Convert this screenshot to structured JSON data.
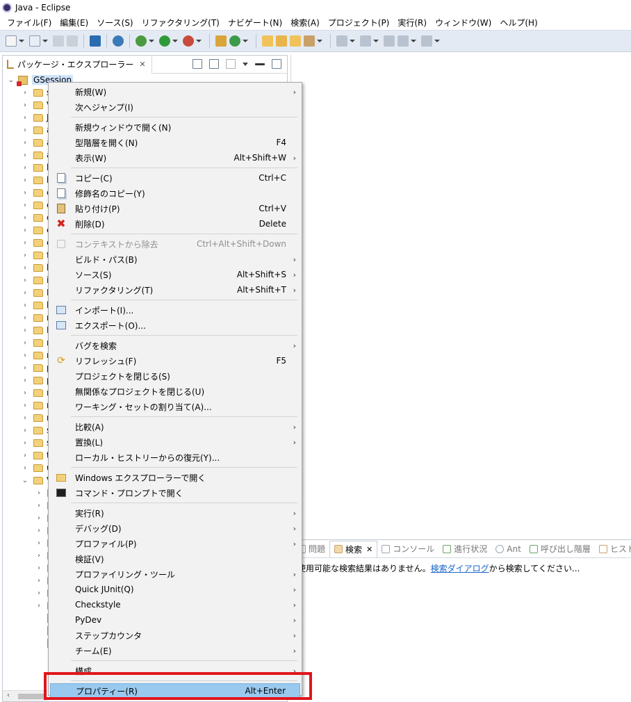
{
  "window": {
    "title": "Java - Eclipse"
  },
  "menubar": {
    "items": [
      "ファイル(F)",
      "編集(E)",
      "ソース(S)",
      "リファクタリング(T)",
      "ナビゲート(N)",
      "検索(A)",
      "プロジェクト(P)",
      "実行(R)",
      "ウィンドウ(W)",
      "ヘルプ(H)"
    ]
  },
  "package_explorer": {
    "tab_label": "パッケージ・エクスプローラー",
    "close_glyph": "✕",
    "project": "GSession",
    "tree_letters": [
      "s",
      "V",
      "J",
      "a",
      "a",
      "a",
      "b",
      "b",
      "c",
      "c",
      "c",
      "e",
      "e",
      "f",
      "h",
      "i",
      "L",
      "l",
      "n",
      "N",
      "n",
      "n",
      "p",
      "p",
      "r",
      "r",
      "r",
      "s",
      "s",
      "t",
      "u",
      "V"
    ]
  },
  "bottom_panel": {
    "tabs": [
      {
        "label": "問題",
        "active": false
      },
      {
        "label": "検索",
        "active": true
      },
      {
        "label": "コンソール",
        "active": false
      },
      {
        "label": "進行状況",
        "active": false
      },
      {
        "label": "Ant",
        "active": false
      },
      {
        "label": "呼び出し階層",
        "active": false
      },
      {
        "label": "ヒストリー",
        "active": false
      }
    ],
    "message_prefix": "使用可能な検索結果はありません。",
    "message_link": "検索ダイアログ",
    "message_suffix": "から検索してください..."
  },
  "context_menu": {
    "items": [
      {
        "label": "新規(W)",
        "shortcut": "",
        "submenu": true,
        "icon": ""
      },
      {
        "label": "次へジャンプ(I)",
        "shortcut": "",
        "submenu": false,
        "icon": ""
      },
      {
        "label": "新規ウィンドウで開く(N)",
        "shortcut": "",
        "submenu": false,
        "icon": ""
      },
      {
        "label": "型階層を開く(N)",
        "shortcut": "F4",
        "submenu": false,
        "icon": ""
      },
      {
        "label": "表示(W)",
        "shortcut": "Alt+Shift+W",
        "submenu": true,
        "icon": ""
      },
      {
        "label": "コピー(C)",
        "shortcut": "Ctrl+C",
        "submenu": false,
        "icon": "copy-icon"
      },
      {
        "label": "修飾名のコピー(Y)",
        "shortcut": "",
        "submenu": false,
        "icon": "copy-qualified-name-icon"
      },
      {
        "label": "貼り付け(P)",
        "shortcut": "Ctrl+V",
        "submenu": false,
        "icon": "paste-icon"
      },
      {
        "label": "削除(D)",
        "shortcut": "Delete",
        "submenu": false,
        "icon": "delete-icon"
      },
      {
        "label": "コンテキストから除去",
        "shortcut": "Ctrl+Alt+Shift+Down",
        "submenu": false,
        "icon": "remove-context-icon",
        "disabled": true
      },
      {
        "label": "ビルド・パス(B)",
        "shortcut": "",
        "submenu": true,
        "icon": ""
      },
      {
        "label": "ソース(S)",
        "shortcut": "Alt+Shift+S",
        "submenu": true,
        "icon": ""
      },
      {
        "label": "リファクタリング(T)",
        "shortcut": "Alt+Shift+T",
        "submenu": true,
        "icon": ""
      },
      {
        "label": "インポート(I)...",
        "shortcut": "",
        "submenu": false,
        "icon": "import-icon"
      },
      {
        "label": "エクスポート(O)...",
        "shortcut": "",
        "submenu": false,
        "icon": "export-icon"
      },
      {
        "label": "バグを検索",
        "shortcut": "",
        "submenu": true,
        "icon": ""
      },
      {
        "label": "リフレッシュ(F)",
        "shortcut": "F5",
        "submenu": false,
        "icon": "refresh-icon"
      },
      {
        "label": "プロジェクトを閉じる(S)",
        "shortcut": "",
        "submenu": false,
        "icon": ""
      },
      {
        "label": "無関係なプロジェクトを閉じる(U)",
        "shortcut": "",
        "submenu": false,
        "icon": ""
      },
      {
        "label": "ワーキング・セットの割り当て(A)...",
        "shortcut": "",
        "submenu": false,
        "icon": ""
      },
      {
        "label": "比較(A)",
        "shortcut": "",
        "submenu": true,
        "icon": ""
      },
      {
        "label": "置換(L)",
        "shortcut": "",
        "submenu": true,
        "icon": ""
      },
      {
        "label": "ローカル・ヒストリーからの復元(Y)...",
        "shortcut": "",
        "submenu": false,
        "icon": ""
      },
      {
        "label": "Windows エクスプローラーで開く",
        "shortcut": "",
        "submenu": false,
        "icon": "explorer-icon"
      },
      {
        "label": "コマンド・プロンプトで開く",
        "shortcut": "",
        "submenu": false,
        "icon": "console-icon"
      },
      {
        "label": "実行(R)",
        "shortcut": "",
        "submenu": true,
        "icon": ""
      },
      {
        "label": "デバッグ(D)",
        "shortcut": "",
        "submenu": true,
        "icon": ""
      },
      {
        "label": "プロファイル(P)",
        "shortcut": "",
        "submenu": true,
        "icon": ""
      },
      {
        "label": "検証(V)",
        "shortcut": "",
        "submenu": false,
        "icon": ""
      },
      {
        "label": "プロファイリング・ツール",
        "shortcut": "",
        "submenu": true,
        "icon": ""
      },
      {
        "label": "Quick JUnit(Q)",
        "shortcut": "",
        "submenu": true,
        "icon": ""
      },
      {
        "label": "Checkstyle",
        "shortcut": "",
        "submenu": true,
        "icon": ""
      },
      {
        "label": "PyDev",
        "shortcut": "",
        "submenu": true,
        "icon": ""
      },
      {
        "label": "ステップカウンタ",
        "shortcut": "",
        "submenu": true,
        "icon": ""
      },
      {
        "label": "チーム(E)",
        "shortcut": "",
        "submenu": true,
        "icon": ""
      },
      {
        "label": "構成",
        "shortcut": "",
        "submenu": true,
        "icon": ""
      },
      {
        "label": "プロパティー(R)",
        "shortcut": "Alt+Enter",
        "submenu": false,
        "icon": "",
        "selected": true
      }
    ],
    "submenu_glyph": "›"
  },
  "colors": {
    "selection": "#99c9ef",
    "highlight_frame": "#e0161d",
    "toolbar": "#e3eaf3",
    "link": "#1a64c8"
  }
}
